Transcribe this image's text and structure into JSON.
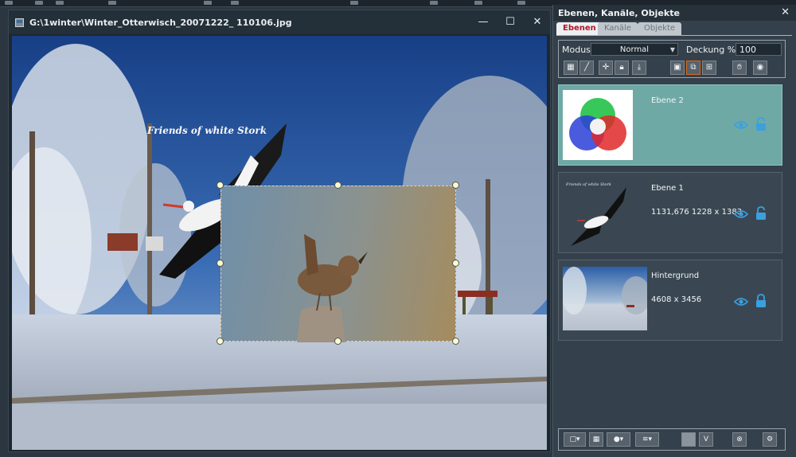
{
  "app": {
    "toolbar_icons": [
      "new-icon",
      "open-icon",
      "save-icon",
      "print-icon",
      "undo-icon",
      "redo-icon",
      "crop-icon",
      "move-icon",
      "play-icon",
      "help-icon"
    ]
  },
  "image_window": {
    "title": "G:\\1winter\\Winter_Otterwisch_20071222_ 110106.jpg",
    "minimize": "—",
    "maximize": "☐",
    "close": "✕",
    "image_caption": "Friends of white Stork"
  },
  "panel": {
    "title": "Ebenen, Kanäle, Objekte",
    "close": "✕",
    "tabs": [
      {
        "label": "Ebenen",
        "active": true
      },
      {
        "label": "Kanäle",
        "active": false
      },
      {
        "label": "Objekte",
        "active": false
      }
    ],
    "mode_label": "Modus",
    "mode_value": "Normal",
    "opacity_label": "Deckung %",
    "opacity_value": "100",
    "layers": [
      {
        "name": "Ebene 2",
        "info": "",
        "selected": true,
        "locked": false
      },
      {
        "name": "Ebene 1",
        "info": "1131,676  1228 x 1383",
        "selected": false,
        "locked": false
      },
      {
        "name": "Hintergrund",
        "info": "4608 x 3456",
        "selected": false,
        "locked": true
      }
    ],
    "bottom_buttons": [
      "new-layer-icon",
      "group-icon",
      "mask-icon",
      "adjust-icon",
      "flatten-icon",
      "visibility-icon",
      "delete-icon",
      "settings-icon"
    ],
    "bottom_v": "V"
  },
  "colors": {
    "accent_red": "#b0182a",
    "selected_layer": "#6fa9a6",
    "icon_blue": "#3aa0e0",
    "panel_bg": "#34404b"
  }
}
